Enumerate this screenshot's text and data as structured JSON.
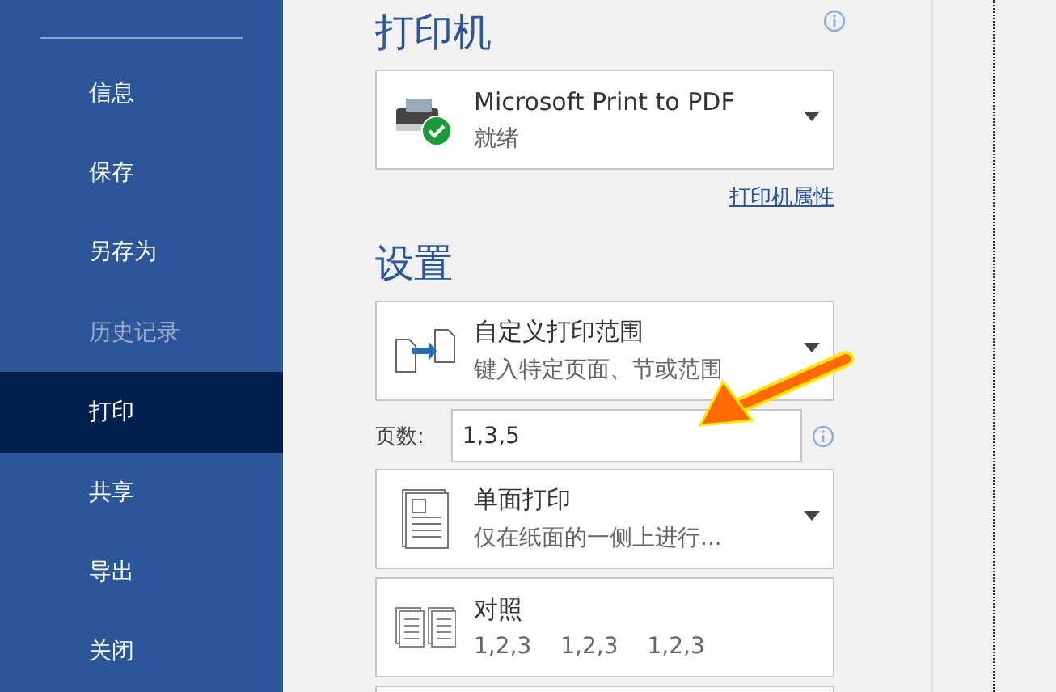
{
  "sidebar": {
    "items": [
      {
        "label": "信息",
        "selected": false,
        "disabled": false
      },
      {
        "label": "保存",
        "selected": false,
        "disabled": false
      },
      {
        "label": "另存为",
        "selected": false,
        "disabled": false
      },
      {
        "label": "历史记录",
        "selected": false,
        "disabled": true
      },
      {
        "label": "打印",
        "selected": true,
        "disabled": false
      },
      {
        "label": "共享",
        "selected": false,
        "disabled": false
      },
      {
        "label": "导出",
        "selected": false,
        "disabled": false
      },
      {
        "label": "关闭",
        "selected": false,
        "disabled": false
      }
    ]
  },
  "printer": {
    "heading": "打印机",
    "selector": {
      "kind": "printer",
      "title": "Microsoft Print to PDF",
      "subtitle": "就绪"
    },
    "properties_link": "打印机属性"
  },
  "settings": {
    "heading": "设置",
    "selectors": [
      {
        "kind": "range",
        "title": "自定义打印范围",
        "subtitle": "键入特定页面、节或范围"
      },
      {
        "kind": "sides",
        "title": "单面打印",
        "subtitle": "仅在纸面的一侧上进行..."
      },
      {
        "kind": "collate",
        "title": "对照",
        "subtitle_parts": [
          "1,2,3",
          "1,2,3",
          "1,2,3"
        ]
      }
    ],
    "pages": {
      "label": "页数:",
      "value": "1,3,5"
    }
  }
}
